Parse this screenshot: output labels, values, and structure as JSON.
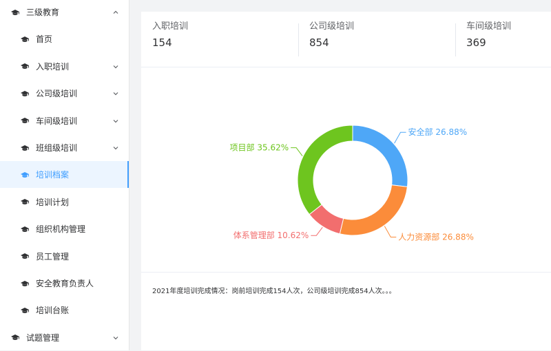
{
  "sidebar": {
    "items": [
      {
        "label": "三级教育",
        "level": "top",
        "icon": "graduation-cap-icon",
        "chevron": "up"
      },
      {
        "label": "首页",
        "level": "sub",
        "icon": "graduation-cap-icon"
      },
      {
        "label": "入职培训",
        "level": "sub",
        "icon": "graduation-cap-icon",
        "chevron": "down"
      },
      {
        "label": "公司级培训",
        "level": "sub",
        "icon": "graduation-cap-icon",
        "chevron": "down"
      },
      {
        "label": "车间级培训",
        "level": "sub",
        "icon": "graduation-cap-icon",
        "chevron": "down"
      },
      {
        "label": "班组级培训",
        "level": "sub",
        "icon": "graduation-cap-icon",
        "chevron": "down"
      },
      {
        "label": "培训档案",
        "level": "sub",
        "icon": "graduation-cap-icon",
        "active": true
      },
      {
        "label": "培训计划",
        "level": "sub",
        "icon": "graduation-cap-icon"
      },
      {
        "label": "组织机构管理",
        "level": "sub",
        "icon": "graduation-cap-icon"
      },
      {
        "label": "员工管理",
        "level": "sub",
        "icon": "graduation-cap-icon"
      },
      {
        "label": "安全教育负责人",
        "level": "sub",
        "icon": "graduation-cap-icon"
      },
      {
        "label": "培训台账",
        "level": "sub",
        "icon": "graduation-cap-icon"
      },
      {
        "label": "试题管理",
        "level": "top",
        "icon": "graduation-cap-icon",
        "chevron": "down"
      }
    ]
  },
  "stats": [
    {
      "label": "入职培训",
      "value": "154"
    },
    {
      "label": "公司级培训",
      "value": "854"
    },
    {
      "label": "车间级培训",
      "value": "369"
    }
  ],
  "colors": {
    "accent": "#409eff",
    "safety": "#4ea7f7",
    "hr": "#fb8c3a",
    "system": "#f26e6e",
    "project": "#6ec51f"
  },
  "chart_data": {
    "type": "pie",
    "variant": "donut",
    "slices": [
      {
        "name": "安全部",
        "percent": 26.88,
        "label": "安全部 26.88%",
        "color": "#4ea7f7"
      },
      {
        "name": "人力资源部",
        "percent": 26.88,
        "label": "人力资源部 26.88%",
        "color": "#fb8c3a"
      },
      {
        "name": "体系管理部",
        "percent": 10.62,
        "label": "体系管理部 10.62%",
        "color": "#f26e6e"
      },
      {
        "name": "项目部",
        "percent": 35.62,
        "label": "项目部 35.62%",
        "color": "#6ec51f"
      }
    ]
  },
  "summary": "2021年度培训完成情况：岗前培训完成154人次，公司级培训完成854人次。。。"
}
